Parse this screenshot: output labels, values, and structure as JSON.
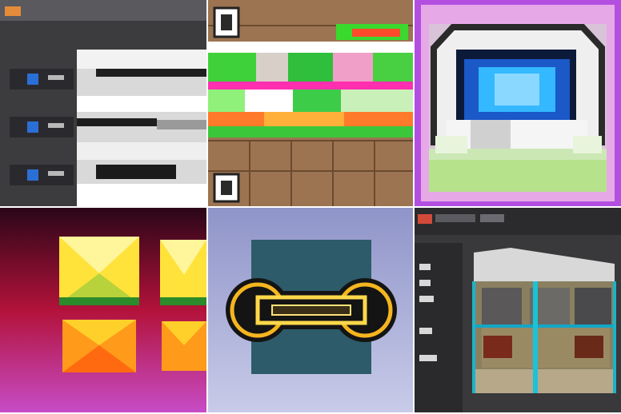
{
  "grid": {
    "tiles": [
      {
        "icon": "dark-ui-screenshot-tile",
        "text": [
          "",
          "",
          "",
          "",
          "",
          ""
        ]
      },
      {
        "icon": "glitch-brick-pattern-tile"
      },
      {
        "icon": "glowing-machine-in-frame-tile"
      },
      {
        "icon": "yellow-orange-cubes-on-red-tile"
      },
      {
        "icon": "glowing-ring-handle-icon-tile"
      },
      {
        "icon": "dark-software-3d-room-tile"
      }
    ]
  },
  "colors": {
    "background": "#ffffff",
    "tile1_bg": "#3c3c3e",
    "tile2_bg": "#9c7451",
    "tile3_bg": "#b34fe0",
    "tile4_bg": "#2a0618",
    "tile5_bg": "#7b7fae",
    "tile6_bg": "#39393b"
  }
}
